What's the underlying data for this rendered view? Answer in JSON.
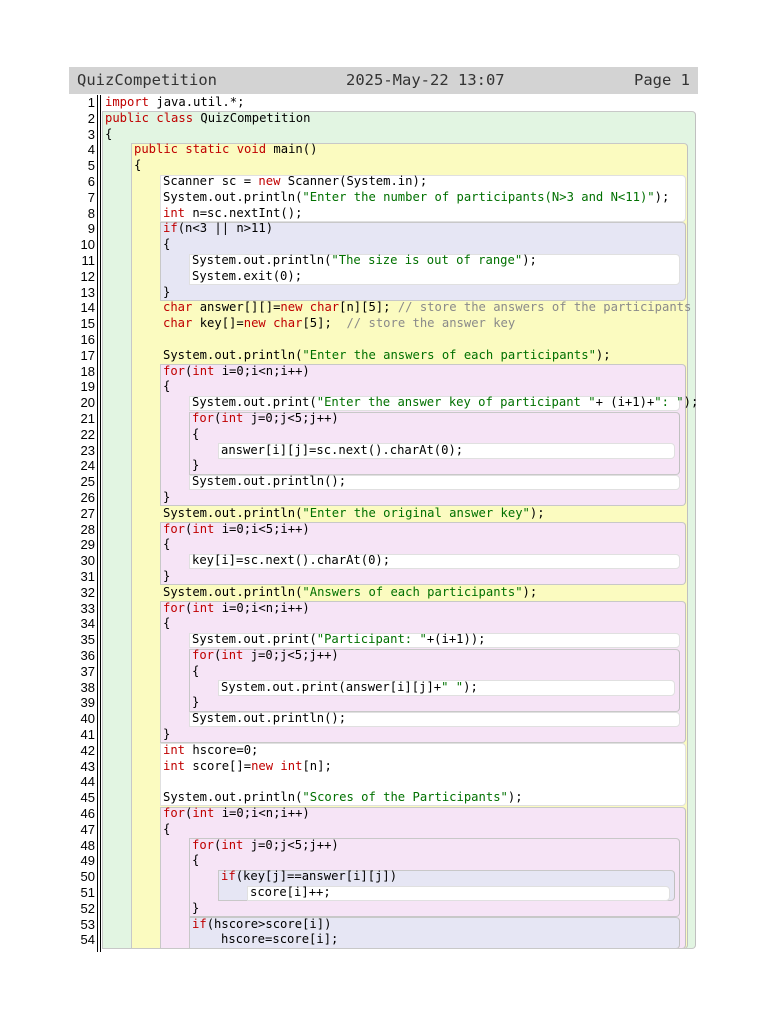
{
  "header": {
    "title": "QuizCompetition",
    "date": "2025-May-22 13:07",
    "page": "Page 1"
  },
  "lines": [
    {
      "n": "1",
      "indent": 0,
      "tokens": [
        {
          "t": "import",
          "c": "kw"
        },
        {
          "t": " java.util.*;"
        }
      ]
    },
    {
      "n": "2",
      "indent": 0,
      "tokens": [
        {
          "t": "public class",
          "c": "kw"
        },
        {
          "t": " QuizCompetition"
        }
      ]
    },
    {
      "n": "3",
      "indent": 0,
      "tokens": [
        {
          "t": "{"
        }
      ]
    },
    {
      "n": "4",
      "indent": 1,
      "tokens": [
        {
          "t": "public static void",
          "c": "kw"
        },
        {
          "t": " main()"
        }
      ]
    },
    {
      "n": "5",
      "indent": 1,
      "tokens": [
        {
          "t": "{"
        }
      ]
    },
    {
      "n": "6",
      "indent": 2,
      "tokens": [
        {
          "t": "Scanner sc = "
        },
        {
          "t": "new",
          "c": "kw"
        },
        {
          "t": " Scanner(System.in);"
        }
      ]
    },
    {
      "n": "7",
      "indent": 2,
      "tokens": [
        {
          "t": "System.out.println("
        },
        {
          "t": "\"Enter the number of participants(N>3 and N<11)\"",
          "c": "str"
        },
        {
          "t": ");"
        }
      ]
    },
    {
      "n": "8",
      "indent": 2,
      "tokens": [
        {
          "t": "int",
          "c": "kw"
        },
        {
          "t": " n=sc.nextInt();"
        }
      ]
    },
    {
      "n": "9",
      "indent": 2,
      "tokens": [
        {
          "t": "if",
          "c": "kw"
        },
        {
          "t": "(n<3 || n>11)"
        }
      ]
    },
    {
      "n": "10",
      "indent": 2,
      "tokens": [
        {
          "t": "{"
        }
      ]
    },
    {
      "n": "11",
      "indent": 3,
      "tokens": [
        {
          "t": "System.out.println("
        },
        {
          "t": "\"The size is out of range\"",
          "c": "str"
        },
        {
          "t": ");"
        }
      ]
    },
    {
      "n": "12",
      "indent": 3,
      "tokens": [
        {
          "t": "System.exit(0);"
        }
      ]
    },
    {
      "n": "13",
      "indent": 2,
      "tokens": [
        {
          "t": "}"
        }
      ]
    },
    {
      "n": "14",
      "indent": 2,
      "tokens": [
        {
          "t": "char",
          "c": "kw"
        },
        {
          "t": " answer[][]="
        },
        {
          "t": "new char",
          "c": "kw"
        },
        {
          "t": "[n][5]; "
        },
        {
          "t": "// store the answers of the participants",
          "c": "cm"
        }
      ]
    },
    {
      "n": "15",
      "indent": 2,
      "tokens": [
        {
          "t": "char",
          "c": "kw"
        },
        {
          "t": " key[]="
        },
        {
          "t": "new char",
          "c": "kw"
        },
        {
          "t": "[5];  "
        },
        {
          "t": "// store the answer key",
          "c": "cm"
        }
      ]
    },
    {
      "n": "16",
      "indent": 2,
      "tokens": []
    },
    {
      "n": "17",
      "indent": 2,
      "tokens": [
        {
          "t": "System.out.println("
        },
        {
          "t": "\"Enter the answers of each participants\"",
          "c": "str"
        },
        {
          "t": ");"
        }
      ]
    },
    {
      "n": "18",
      "indent": 2,
      "tokens": [
        {
          "t": "for",
          "c": "kw"
        },
        {
          "t": "("
        },
        {
          "t": "int",
          "c": "kw"
        },
        {
          "t": " i=0;i<n;i++)"
        }
      ]
    },
    {
      "n": "19",
      "indent": 2,
      "tokens": [
        {
          "t": "{"
        }
      ]
    },
    {
      "n": "20",
      "indent": 3,
      "tokens": [
        {
          "t": "System.out.print("
        },
        {
          "t": "\"Enter the answer key of participant \"",
          "c": "str"
        },
        {
          "t": "+ (i+1)+"
        },
        {
          "t": "\": \"",
          "c": "str"
        },
        {
          "t": ");"
        }
      ]
    },
    {
      "n": "21",
      "indent": 3,
      "tokens": [
        {
          "t": "for",
          "c": "kw"
        },
        {
          "t": "("
        },
        {
          "t": "int",
          "c": "kw"
        },
        {
          "t": " j=0;j<5;j++)"
        }
      ]
    },
    {
      "n": "22",
      "indent": 3,
      "tokens": [
        {
          "t": "{"
        }
      ]
    },
    {
      "n": "23",
      "indent": 4,
      "tokens": [
        {
          "t": "answer[i][j]=sc.next().charAt(0);"
        }
      ]
    },
    {
      "n": "24",
      "indent": 3,
      "tokens": [
        {
          "t": "}"
        }
      ]
    },
    {
      "n": "25",
      "indent": 3,
      "tokens": [
        {
          "t": "System.out.println();"
        }
      ]
    },
    {
      "n": "26",
      "indent": 2,
      "tokens": [
        {
          "t": "}"
        }
      ]
    },
    {
      "n": "27",
      "indent": 2,
      "tokens": [
        {
          "t": "System.out.println("
        },
        {
          "t": "\"Enter the original answer key\"",
          "c": "str"
        },
        {
          "t": ");"
        }
      ]
    },
    {
      "n": "28",
      "indent": 2,
      "tokens": [
        {
          "t": "for",
          "c": "kw"
        },
        {
          "t": "("
        },
        {
          "t": "int",
          "c": "kw"
        },
        {
          "t": " i=0;i<5;i++)"
        }
      ]
    },
    {
      "n": "29",
      "indent": 2,
      "tokens": [
        {
          "t": "{"
        }
      ]
    },
    {
      "n": "30",
      "indent": 3,
      "tokens": [
        {
          "t": "key[i]=sc.next().charAt(0);"
        }
      ]
    },
    {
      "n": "31",
      "indent": 2,
      "tokens": [
        {
          "t": "}"
        }
      ]
    },
    {
      "n": "32",
      "indent": 2,
      "tokens": [
        {
          "t": "System.out.println("
        },
        {
          "t": "\"Answers of each participants\"",
          "c": "str"
        },
        {
          "t": ");"
        }
      ]
    },
    {
      "n": "33",
      "indent": 2,
      "tokens": [
        {
          "t": "for",
          "c": "kw"
        },
        {
          "t": "("
        },
        {
          "t": "int",
          "c": "kw"
        },
        {
          "t": " i=0;i<n;i++)"
        }
      ]
    },
    {
      "n": "34",
      "indent": 2,
      "tokens": [
        {
          "t": "{"
        }
      ]
    },
    {
      "n": "35",
      "indent": 3,
      "tokens": [
        {
          "t": "System.out.print("
        },
        {
          "t": "\"Participant: \"",
          "c": "str"
        },
        {
          "t": "+(i+1));"
        }
      ]
    },
    {
      "n": "36",
      "indent": 3,
      "tokens": [
        {
          "t": "for",
          "c": "kw"
        },
        {
          "t": "("
        },
        {
          "t": "int",
          "c": "kw"
        },
        {
          "t": " j=0;j<5;j++)"
        }
      ]
    },
    {
      "n": "37",
      "indent": 3,
      "tokens": [
        {
          "t": "{"
        }
      ]
    },
    {
      "n": "38",
      "indent": 4,
      "tokens": [
        {
          "t": "System.out.print(answer[i][j]+"
        },
        {
          "t": "\" \"",
          "c": "str"
        },
        {
          "t": ");"
        }
      ]
    },
    {
      "n": "39",
      "indent": 3,
      "tokens": [
        {
          "t": "}"
        }
      ]
    },
    {
      "n": "40",
      "indent": 3,
      "tokens": [
        {
          "t": "System.out.println();"
        }
      ]
    },
    {
      "n": "41",
      "indent": 2,
      "tokens": [
        {
          "t": "}"
        }
      ]
    },
    {
      "n": "42",
      "indent": 2,
      "tokens": [
        {
          "t": "int",
          "c": "kw"
        },
        {
          "t": " hscore=0;"
        }
      ]
    },
    {
      "n": "43",
      "indent": 2,
      "tokens": [
        {
          "t": "int",
          "c": "kw"
        },
        {
          "t": " score[]="
        },
        {
          "t": "new int",
          "c": "kw"
        },
        {
          "t": "[n];"
        }
      ]
    },
    {
      "n": "44",
      "indent": 2,
      "tokens": []
    },
    {
      "n": "45",
      "indent": 2,
      "tokens": [
        {
          "t": "System.out.println("
        },
        {
          "t": "\"Scores of the Participants\"",
          "c": "str"
        },
        {
          "t": ");"
        }
      ]
    },
    {
      "n": "46",
      "indent": 2,
      "tokens": [
        {
          "t": "for",
          "c": "kw"
        },
        {
          "t": "("
        },
        {
          "t": "int",
          "c": "kw"
        },
        {
          "t": " i=0;i<n;i++)"
        }
      ]
    },
    {
      "n": "47",
      "indent": 2,
      "tokens": [
        {
          "t": "{"
        }
      ]
    },
    {
      "n": "48",
      "indent": 3,
      "tokens": [
        {
          "t": "for",
          "c": "kw"
        },
        {
          "t": "("
        },
        {
          "t": "int",
          "c": "kw"
        },
        {
          "t": " j=0;j<5;j++)"
        }
      ]
    },
    {
      "n": "49",
      "indent": 3,
      "tokens": [
        {
          "t": "{"
        }
      ]
    },
    {
      "n": "50",
      "indent": 4,
      "tokens": [
        {
          "t": "if",
          "c": "kw"
        },
        {
          "t": "(key[j]==answer[i][j])"
        }
      ]
    },
    {
      "n": "51",
      "indent": 5,
      "tokens": [
        {
          "t": "score[i]++;"
        }
      ]
    },
    {
      "n": "52",
      "indent": 3,
      "tokens": [
        {
          "t": "}"
        }
      ]
    },
    {
      "n": "53",
      "indent": 3,
      "tokens": [
        {
          "t": "if",
          "c": "kw"
        },
        {
          "t": "(hscore>score[i])"
        }
      ]
    },
    {
      "n": "54",
      "indent": 4,
      "tokens": [
        {
          "t": "hscore=score[i];"
        }
      ]
    }
  ],
  "colors": {
    "class_block": "#e2f5e2",
    "method_block": "#fbfbc0",
    "if_block": "#e6e6f4",
    "for_block": "#f6e4f6",
    "inner_block": "#ffffff"
  }
}
